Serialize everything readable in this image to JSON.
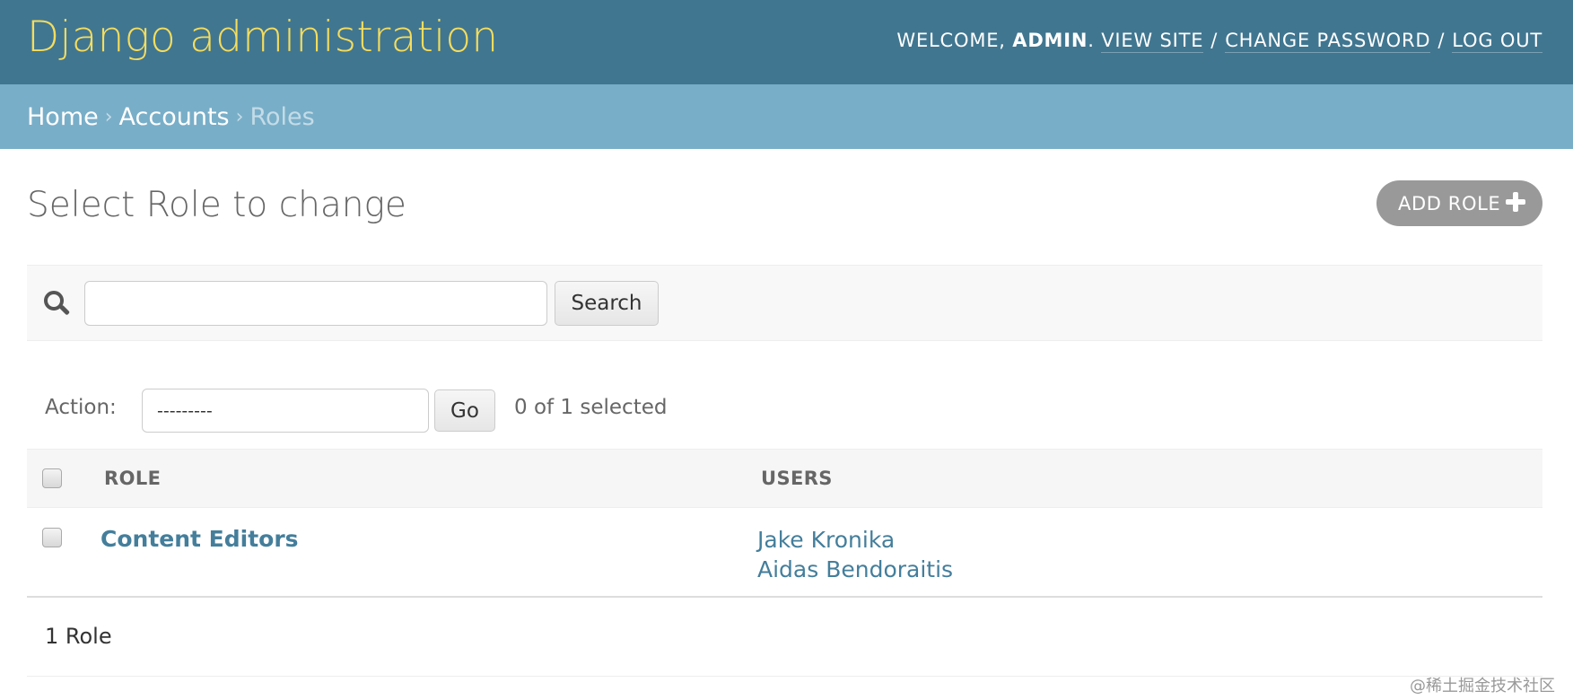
{
  "header": {
    "branding": "Django administration",
    "welcome_label": "WELCOME,",
    "username": "ADMIN",
    "view_site": "VIEW SITE",
    "change_password": "CHANGE PASSWORD",
    "log_out": "LOG OUT",
    "sep": "/"
  },
  "breadcrumbs": {
    "home": "Home",
    "accounts": "Accounts",
    "current": "Roles",
    "arrow": "›"
  },
  "page": {
    "title": "Select Role to change",
    "add_button": "ADD ROLE"
  },
  "search": {
    "value": "",
    "button": "Search"
  },
  "actions": {
    "label": "Action:",
    "selected_option": "---------",
    "go": "Go",
    "counter": "0 of 1 selected"
  },
  "table": {
    "columns": [
      "ROLE",
      "USERS"
    ],
    "rows": [
      {
        "role": "Content Editors",
        "users": [
          "Jake Kronika",
          "Aidas Bendoraitis"
        ]
      }
    ]
  },
  "paginator": {
    "text": "1 Role"
  },
  "watermark": "@稀土掘金技术社区",
  "colors": {
    "header_bg": "#417690",
    "branding": "#f5dd5d",
    "breadcrumbs_bg": "#79aec8",
    "link": "#447e9b",
    "add_button_bg": "#999999"
  }
}
